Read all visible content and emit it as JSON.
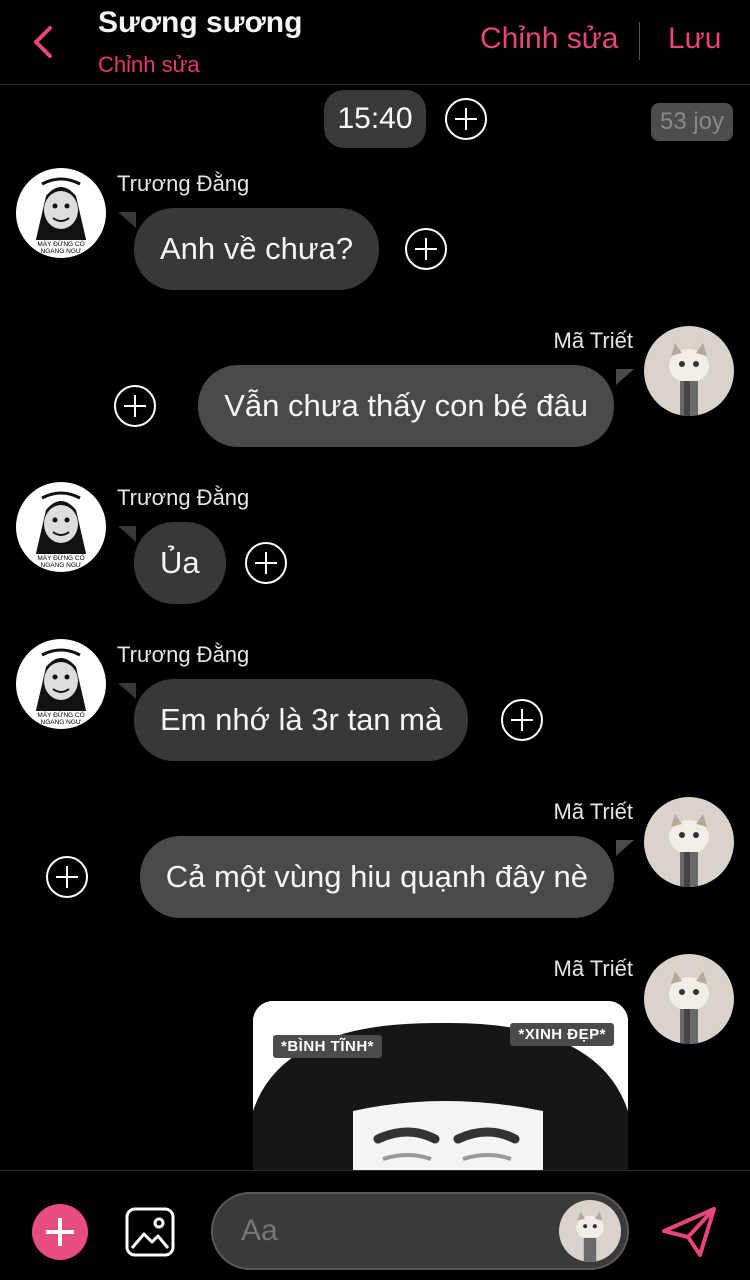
{
  "header": {
    "title": "Sương sương",
    "subtitle": "Chỉnh sửa",
    "edit_label": "Chỉnh sửa",
    "save_label": "Lưu"
  },
  "chat": {
    "time": "15:40",
    "points_badge": "53 joy",
    "messages": [
      {
        "sender": "Trương Đằng",
        "text": "Anh về chưa?",
        "side": "left"
      },
      {
        "sender": "Mã Triết",
        "text": "Vẫn chưa thấy con bé đâu",
        "side": "right"
      },
      {
        "sender": "Trương Đằng",
        "text": "Ủa",
        "side": "left"
      },
      {
        "sender": "Trương Đằng",
        "text": "Em nhớ là 3r tan mà",
        "side": "left"
      },
      {
        "sender": "Mã Triết",
        "text": "Cả một vùng hiu quạnh đây nè",
        "side": "right"
      },
      {
        "sender": "Mã Triết",
        "text": "",
        "side": "right",
        "sticker": true
      }
    ],
    "avatar_left_caption": "MÀY ĐỪNG CÓ\nNGANG NGƯ",
    "sticker_tag_left": "*BÌNH TĨNH*",
    "sticker_tag_right": "*XINH ĐẸP*"
  },
  "composer": {
    "placeholder": "Aa"
  },
  "colors": {
    "accent": "#e8457a",
    "background": "#000000",
    "bubble": "#383838"
  },
  "icons": {
    "back": "chevron-left-icon",
    "add": "plus-icon",
    "image": "image-icon",
    "send": "send-icon"
  }
}
